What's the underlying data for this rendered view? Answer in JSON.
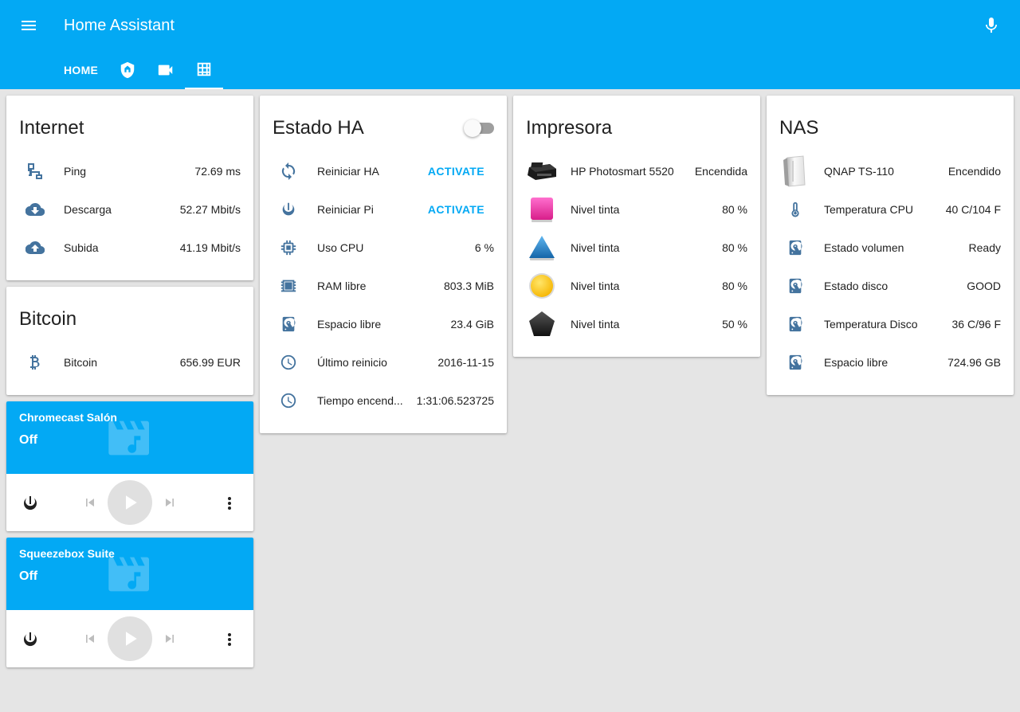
{
  "header": {
    "title": "Home Assistant",
    "tabs": [
      {
        "label": "HOME",
        "icon": "home-text"
      },
      {
        "label": "",
        "icon": "security-shield-icon"
      },
      {
        "label": "",
        "icon": "video-camera-icon"
      },
      {
        "label": "",
        "icon": "grid-icon"
      }
    ]
  },
  "colors": {
    "primary": "#03a9f4",
    "icon": "#44739e",
    "background": "#e5e5e5"
  },
  "internet": {
    "title": "Internet",
    "rows": [
      {
        "icon": "network-icon",
        "name": "Ping",
        "value": "72.69 ms"
      },
      {
        "icon": "cloud-download-icon",
        "name": "Descarga",
        "value": "52.27 Mbit/s"
      },
      {
        "icon": "cloud-upload-icon",
        "name": "Subida",
        "value": "41.19 Mbit/s"
      }
    ]
  },
  "bitcoin": {
    "title": "Bitcoin",
    "rows": [
      {
        "icon": "bitcoin-icon",
        "name": "Bitcoin",
        "value": "656.99 EUR"
      }
    ]
  },
  "estado": {
    "title": "Estado HA",
    "toggle": "off",
    "rows": [
      {
        "icon": "restart-icon",
        "name": "Reiniciar HA",
        "action": "ACTIVATE"
      },
      {
        "icon": "power-icon",
        "name": "Reiniciar Pi",
        "action": "ACTIVATE"
      },
      {
        "icon": "chip-icon",
        "name": "Uso CPU",
        "value": "6 %"
      },
      {
        "icon": "memory-icon",
        "name": "RAM libre",
        "value": "803.3 MiB"
      },
      {
        "icon": "harddisk-icon",
        "name": "Espacio libre",
        "value": "23.4 GiB"
      },
      {
        "icon": "clock-icon",
        "name": "Último reinicio",
        "value": "2016-11-15"
      },
      {
        "icon": "clock-icon",
        "name": "Tiempo encend...",
        "value": "1:31:06.523725"
      }
    ]
  },
  "impresora": {
    "title": "Impresora",
    "rows": [
      {
        "icon": "printer-image",
        "name": "HP Photosmart 5520",
        "value": "Encendida"
      },
      {
        "icon": "ink-magenta-square",
        "name": "Nivel tinta",
        "value": "80 %"
      },
      {
        "icon": "ink-cyan-triangle",
        "name": "Nivel tinta",
        "value": "80 %"
      },
      {
        "icon": "ink-yellow-circle",
        "name": "Nivel tinta",
        "value": "80 %"
      },
      {
        "icon": "ink-black-pentagon",
        "name": "Nivel tinta",
        "value": "50 %"
      }
    ]
  },
  "nas": {
    "title": "NAS",
    "rows": [
      {
        "icon": "nas-image",
        "name": "QNAP TS-110",
        "value": "Encendido"
      },
      {
        "icon": "thermometer-icon",
        "name": "Temperatura CPU",
        "value": "40 C/104 F"
      },
      {
        "icon": "harddisk-icon",
        "name": "Estado volumen",
        "value": "Ready"
      },
      {
        "icon": "harddisk-icon",
        "name": "Estado disco",
        "value": "GOOD"
      },
      {
        "icon": "harddisk-icon",
        "name": "Temperatura Disco",
        "value": "36 C/96 F"
      },
      {
        "icon": "harddisk-icon",
        "name": "Espacio libre",
        "value": "724.96 GB"
      }
    ]
  },
  "media": [
    {
      "name": "Chromecast Salón",
      "state": "Off"
    },
    {
      "name": "Squeezebox Suite",
      "state": "Off"
    }
  ]
}
